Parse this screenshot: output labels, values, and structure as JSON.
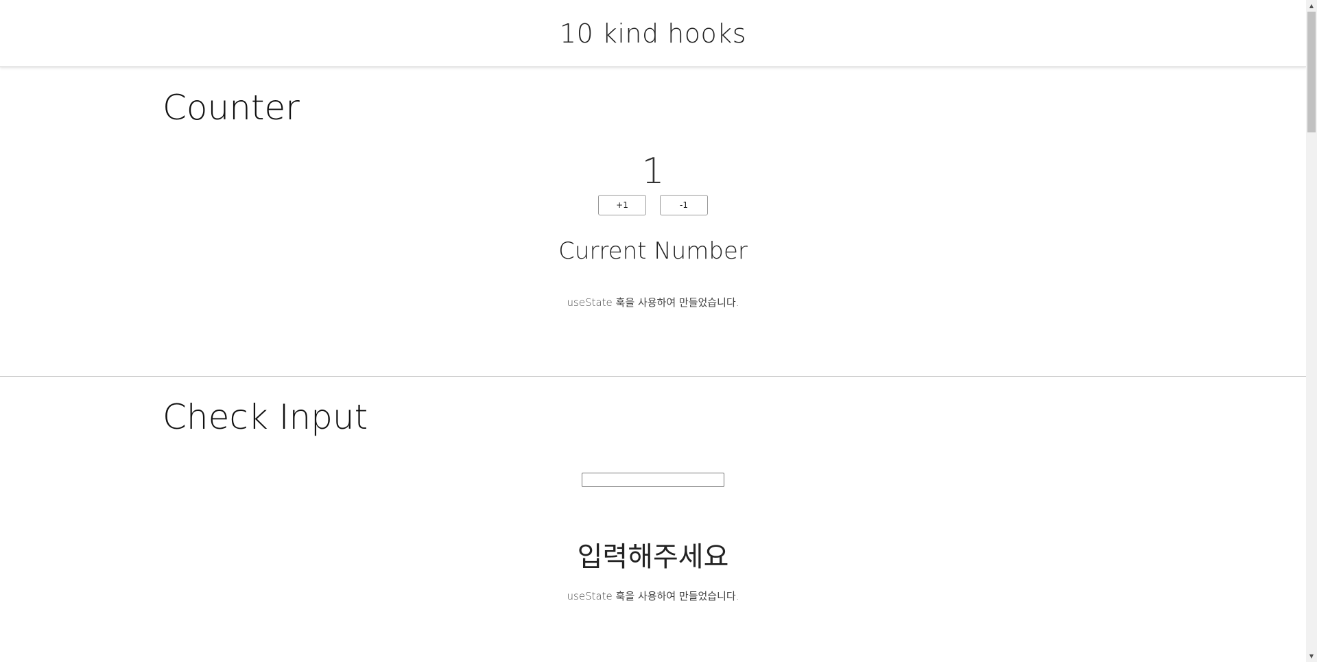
{
  "header": {
    "title": "10 kind hooks"
  },
  "counter": {
    "title": "Counter",
    "value": "1",
    "increment_label": "+1",
    "decrement_label": "-1",
    "subheading": "Current Number",
    "note": "useState 훅을 사용하여 만들었습니다."
  },
  "check_input": {
    "title": "Check Input",
    "input_value": "",
    "subheading": "입력해주세요",
    "note": "useState 훅을 사용하여 만들었습니다."
  },
  "scrollbar": {
    "up_icon": "scroll-up-arrow",
    "down_icon": "scroll-down-arrow"
  }
}
